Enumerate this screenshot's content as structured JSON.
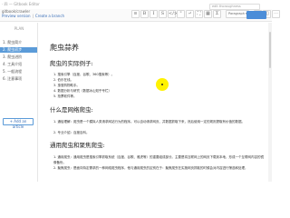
{
  "window": {
    "title": "· 四 — Gitbook Editor"
  },
  "header": {
    "repo_name": "gitbook/crawler",
    "links": [
      "Preview version",
      "Create a branch"
    ]
  },
  "toolbar": {
    "buttons": [
      "≡",
      "B",
      "I",
      "S",
      "</>",
      "\"",
      "⤶",
      "⛶",
      "▦",
      "Σ"
    ],
    "style_select": "Paragraph ▾",
    "buttons_right": [
      "≡",
      "◫",
      "⋯"
    ]
  },
  "sidebar": {
    "section_label": "PLAN",
    "items": [
      "1. 爬虫简介",
      "2. 爬虫初步",
      "3. 爬虫进阶",
      "4. 工具介绍",
      "5. 一般流程",
      "6. 注意事项"
    ],
    "active_index": 1,
    "add_article": "+ Add an article"
  },
  "editor": {
    "subject_placeholder": "edit thoroughness"
  },
  "doc": {
    "title": "爬虫蒜养",
    "section1_heading": "爬虫的实际例子:",
    "section1_items": [
      "1. 搜索引擎（百度、谷歌、360搜索等）。",
      "2. 伯乐在线。",
      "3. 惠惠购物助手。",
      "4. 数据分析与研究（数据冰山知乎专栏）",
      "5. 抢票软件等。"
    ],
    "section2_heading": "什么是网络爬虫:",
    "section2_items": [
      "1. 通俗理解：爬虫是一个模拟人类请求网站行为的程序。可以自动请求网页、并数据抓取下来，然后使用一定的规则提取有价值的数据。",
      "2. 专业介绍：百度百科。"
    ],
    "section3_heading": "通用爬虫和聚焦爬虫:",
    "section3_items": [
      "1. 通用爬虫：通用爬虫是搜索引擎抓取系统（百度、谷歌、雅虎等）的重要组成部分。主要是将互联网上的网页下载到本地，形成一个互联网内容的镜像备份。",
      "2. 聚焦爬虫：是面向特定需求的一种网络爬虫程序，他与通用爬虫的区别在于：聚焦爬虫在实施网页抓取的时候会对内容进行筛选和处理，"
    ]
  }
}
